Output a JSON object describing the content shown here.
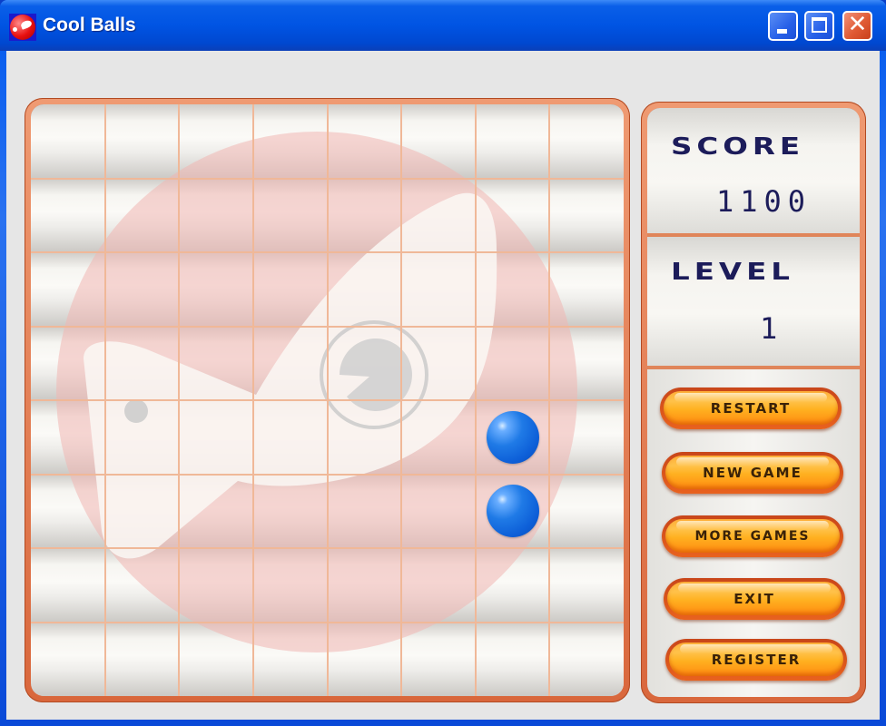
{
  "window": {
    "title": "Cool Balls",
    "app_icon": "cool-balls-logo-icon",
    "controls": {
      "minimize_icon": "minimize-icon",
      "maximize_icon": "maximize-icon",
      "close_glyph": "✕"
    }
  },
  "board": {
    "rows": 8,
    "cols": 8,
    "watermark": "cool-balls-logo",
    "balls": [
      {
        "row": 4,
        "col": 6,
        "color": "#1f7ae6"
      },
      {
        "row": 5,
        "col": 6,
        "color": "#1f7ae6"
      }
    ]
  },
  "sidebar": {
    "score_label": "SCORE",
    "score_value": "1100",
    "level_label": "LEVEL",
    "level_value": "1",
    "buttons": [
      {
        "id": "restart",
        "label": "RESTART"
      },
      {
        "id": "new-game",
        "label": "NEW GAME"
      },
      {
        "id": "more-games",
        "label": "MORE GAMES"
      },
      {
        "id": "exit",
        "label": "EXIT"
      },
      {
        "id": "register",
        "label": "REGISTER"
      }
    ]
  },
  "colors": {
    "frame": "#e0764a",
    "ball": "#1f7ae6",
    "button": "#ffb020",
    "label_text": "#1c1c5a"
  }
}
